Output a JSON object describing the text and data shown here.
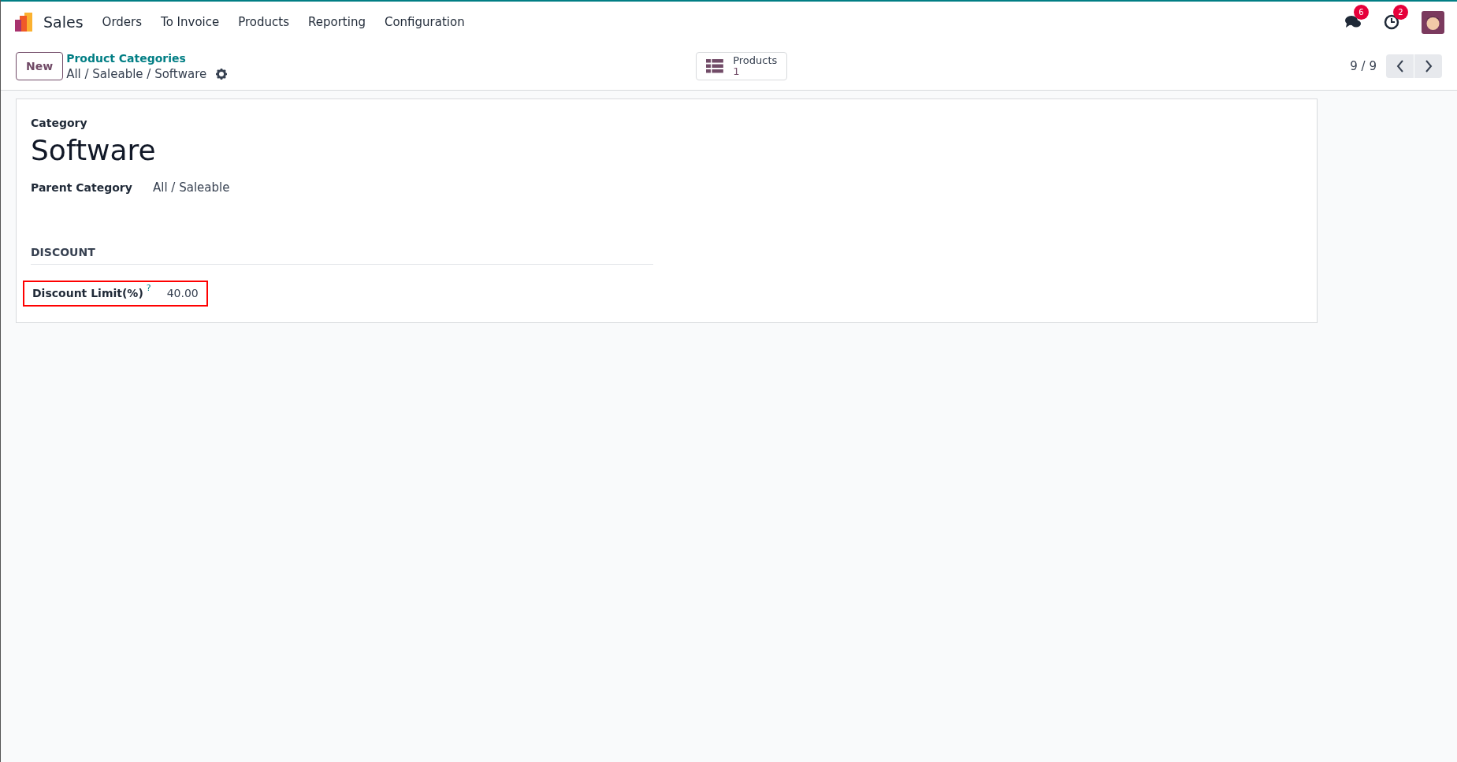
{
  "navbar": {
    "app": "Sales",
    "menu": [
      "Orders",
      "To Invoice",
      "Products",
      "Reporting",
      "Configuration"
    ],
    "messages_badge": "6",
    "activities_badge": "2"
  },
  "control_panel": {
    "new_button": "New",
    "breadcrumb": "Product Categories",
    "record_path": "All / Saleable / Software",
    "smart_button": {
      "label": "Products",
      "value": "1"
    },
    "pager": "9 / 9"
  },
  "form": {
    "category_label": "Category",
    "name": "Software",
    "parent_label": "Parent Category",
    "parent_value": "All / Saleable",
    "section": "DISCOUNT",
    "fields": [
      {
        "label": "Discount Limit(%)",
        "help": "?",
        "value": "40.00",
        "highlighted": true
      }
    ]
  }
}
